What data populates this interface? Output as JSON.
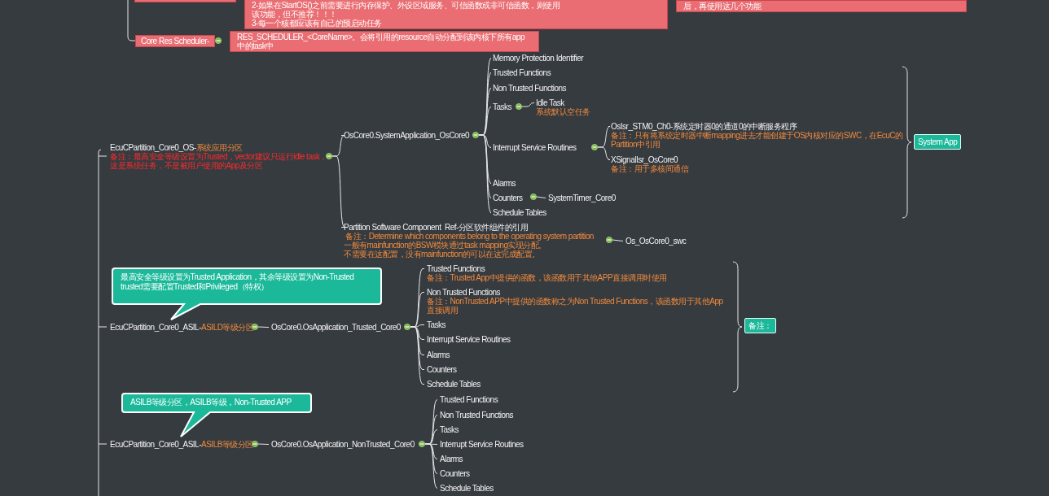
{
  "top_notes": [
    {
      "lines": [
        "2-如果在StartOS()之前需要进行内存保护、外设区域服务、可信函数或非可信函数，则使用",
        "该功能，但不推荐！！！",
        "3-每一个核都应该有自己的预启动任务"
      ]
    },
    {
      "lines": [
        "后，再使用这几个功能"
      ]
    }
  ],
  "scheduler": {
    "label": "Core Res Scheduler-",
    "note": "RES_SCHEDULER_<CoreName>。会将引用的resource自动分配到该内核下所有app中的task中"
  },
  "partitions": [
    {
      "name": "EcuCPartition_Core0_OS-",
      "suffix": "系统应用分区",
      "notes": [
        "备注：最高安全等级设置为Trusted，vector建议只运行idle task，",
        "这是系统任务，不是被用户使用的App及分区"
      ],
      "summary": "System App",
      "apps": [
        {
          "name": "OsCore0.SystemApplication_OsCore0",
          "children": [
            {
              "name": "Memory Protection Identifier"
            },
            {
              "name": "Trusted Functions"
            },
            {
              "name": "Non Trusted Functions"
            },
            {
              "name": "Tasks",
              "children": [
                {
                  "name": "Idle Task",
                  "notes": [
                    "系统默认空任务"
                  ]
                }
              ]
            },
            {
              "name": "Interrupt Service Routines",
              "children": [
                {
                  "name": "OsIsr_STM0_Ch0-系统定时器0的通道0的中断服务程序",
                  "notes": [
                    "备注：只有将系统定时器中断mapping进去才能创建于OS内核对应的SWC，在EcuC的",
                    "Partition中引用"
                  ]
                },
                {
                  "name": "XSignalIsr_OsCore0",
                  "notes": [
                    "备注：用于多核间通信"
                  ]
                }
              ]
            },
            {
              "name": "Alarms"
            },
            {
              "name": "Counters",
              "children": [
                {
                  "name": "SystemTimer_Core0"
                }
              ]
            },
            {
              "name": "Schedule Tables"
            }
          ]
        },
        {
          "name": "Partition Software Component  Ref-分区软件组件的引用",
          "notes": [
            " 备注：Determine which components belong to the operating system partition",
            "一般有mainfunction的BSW模块通过task mapping实现分配。",
            "不需要在这配置，没有mainfunction的可以在这完成配置。"
          ],
          "children": [
            {
              "name": "Os_OsCore0_swc"
            }
          ]
        }
      ]
    },
    {
      "name": "EcuCPartition_Core0_ASIL-",
      "suffix": "ASILD等级分区",
      "callout": [
        "最高安全等级设置为Trusted Application，其余等级设置为Non-Trusted",
        "trusted需要配置Trusted和Privileged（特权）"
      ],
      "summary": "备注：",
      "apps": [
        {
          "name": "OsCore0.OsApplication_Trusted_Core0",
          "children": [
            {
              "name": "Trusted Functions",
              "notes": [
                "备注：Trusted App中提供的函数，该函数用于其他APP直接调用时使用"
              ]
            },
            {
              "name": "Non Trusted Functions",
              "notes": [
                "备注：NonTrusted APP中提供的函数称之为Non Trusted Functions，该函数用于其他App",
                "直接调用"
              ]
            },
            {
              "name": "Tasks"
            },
            {
              "name": "Interrupt Service Routines"
            },
            {
              "name": "Alarms"
            },
            {
              "name": "Counters"
            },
            {
              "name": "Schedule Tables"
            }
          ]
        }
      ]
    },
    {
      "name": "EcuCPartition_Core0_ASIL-",
      "suffix": "ASILB等级分区",
      "callout": [
        "ASILB等级分区，ASILB等级，Non-Trusted APP"
      ],
      "apps": [
        {
          "name": "OsCore0.OsApplication_NonTrusted_Core0",
          "children": [
            {
              "name": "Trusted Functions"
            },
            {
              "name": "Non Trusted Functions"
            },
            {
              "name": "Tasks"
            },
            {
              "name": "Interrupt Service Routines"
            },
            {
              "name": "Alarms"
            },
            {
              "name": "Counters"
            },
            {
              "name": "Schedule Tables"
            }
          ]
        }
      ]
    }
  ]
}
